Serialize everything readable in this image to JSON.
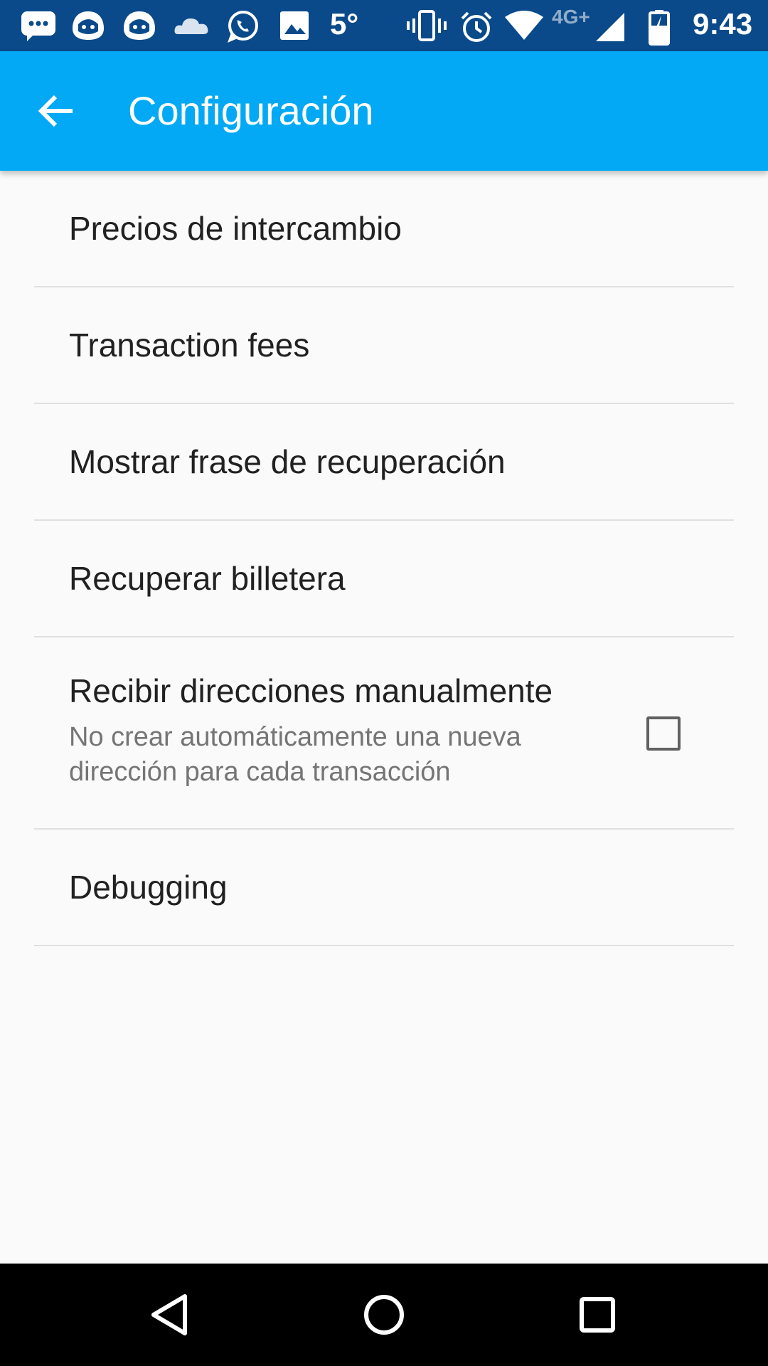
{
  "status_bar": {
    "temperature": "5°",
    "network_type": "4G+",
    "time": "9:43",
    "icons": [
      "messages-icon",
      "bitmoji-icon",
      "bitmoji-icon",
      "cloud-icon",
      "whatsapp-icon",
      "image-icon",
      "vibrate-icon",
      "alarm-icon",
      "wifi-icon",
      "signal-icon",
      "battery-icon"
    ]
  },
  "app_bar": {
    "title": "Configuración",
    "background": "#03a9f4"
  },
  "settings": {
    "exchange_rates": "Precios de intercambio",
    "transaction_fees": "Transaction fees",
    "show_recovery_phrase": "Mostrar frase de recuperación",
    "restore_wallet": "Recuperar billetera",
    "manual_addresses": {
      "label": "Recibir direcciones manualmente",
      "summary": "No crear automáticamente una nueva dirección para cada transacción",
      "checked": false
    },
    "debugging": "Debugging"
  },
  "nav_bar": {
    "icons": [
      "back-triangle-icon",
      "home-circle-icon",
      "recents-square-icon"
    ]
  }
}
